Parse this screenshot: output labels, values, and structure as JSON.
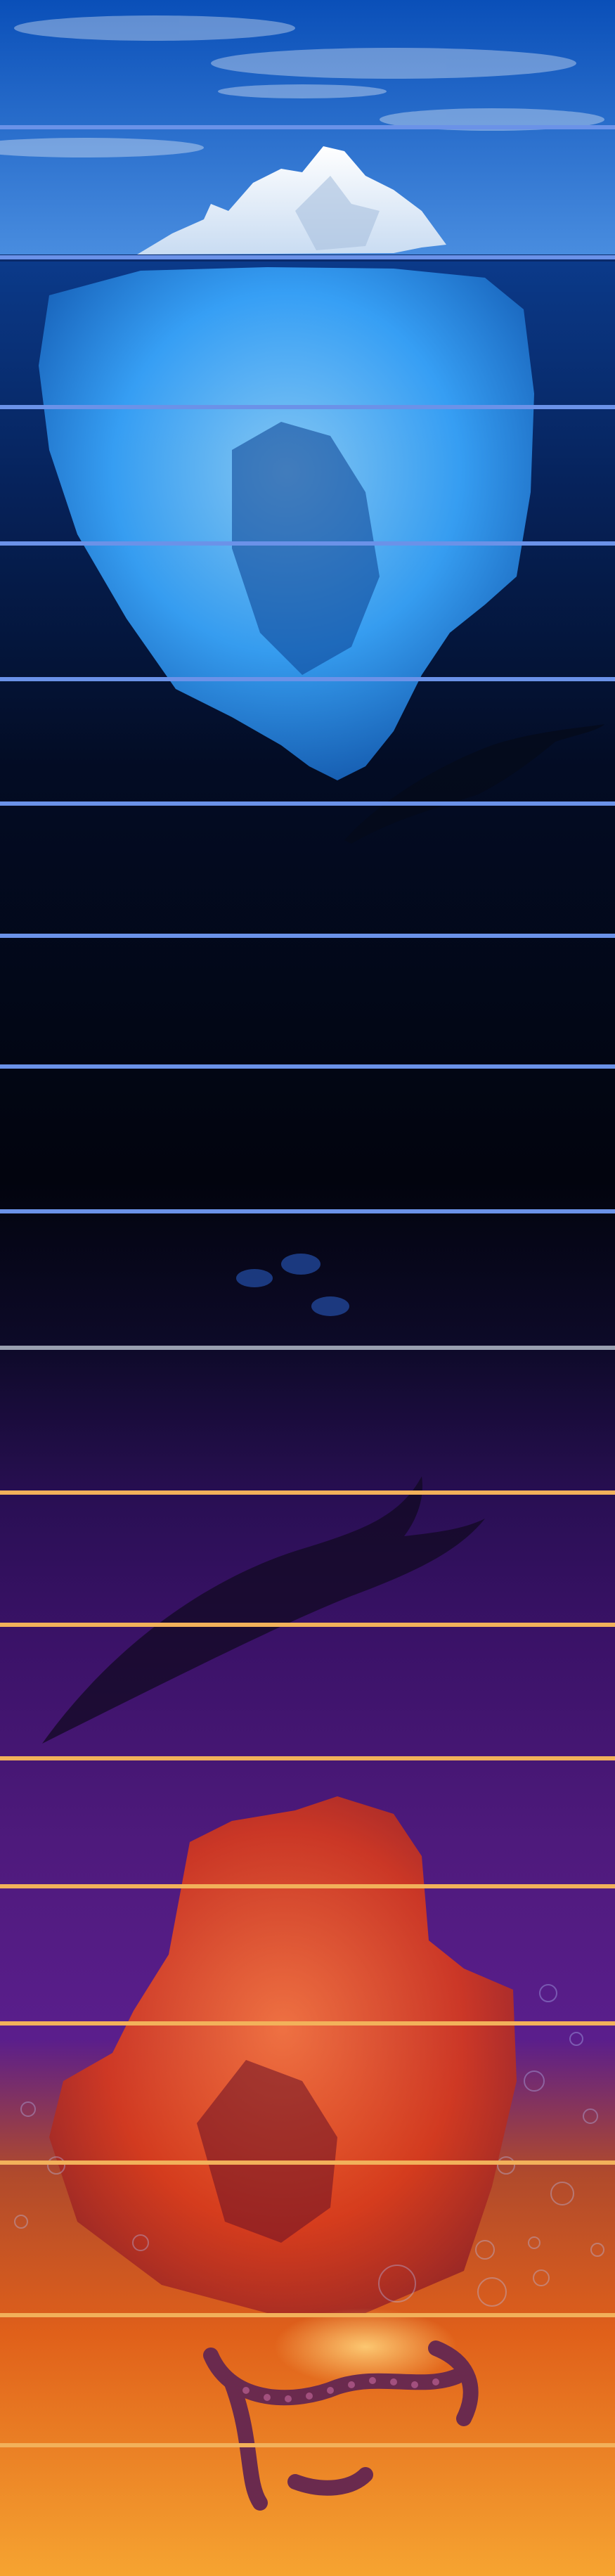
{
  "scene": {
    "colors": {
      "sky_top": "#0a4fb8",
      "sky_bottom": "#4a8ee0",
      "sea_surface": "#0b3a8a",
      "deep_sea": "#02040e",
      "abyss_violet": "#3b1268",
      "purple_glow": "#5a1e8c",
      "lava_orange": "#e0601a",
      "lava_bright": "#f6a431",
      "ice_white": "#f4f8ff",
      "ice_blue": "#3aa8ff",
      "ice_red": "#d83a1c",
      "divider_blue": "#6b92e8",
      "divider_gray": "#9aa0b0",
      "divider_gold": "#f2b15a"
    },
    "icons": [
      "sky-clouds",
      "iceberg-tip",
      "submerged-iceberg",
      "whale-silhouette",
      "jellyfish-cluster",
      "shark-silhouette",
      "inverted-red-iceberg",
      "bubbles",
      "octopus-tentacles"
    ]
  }
}
